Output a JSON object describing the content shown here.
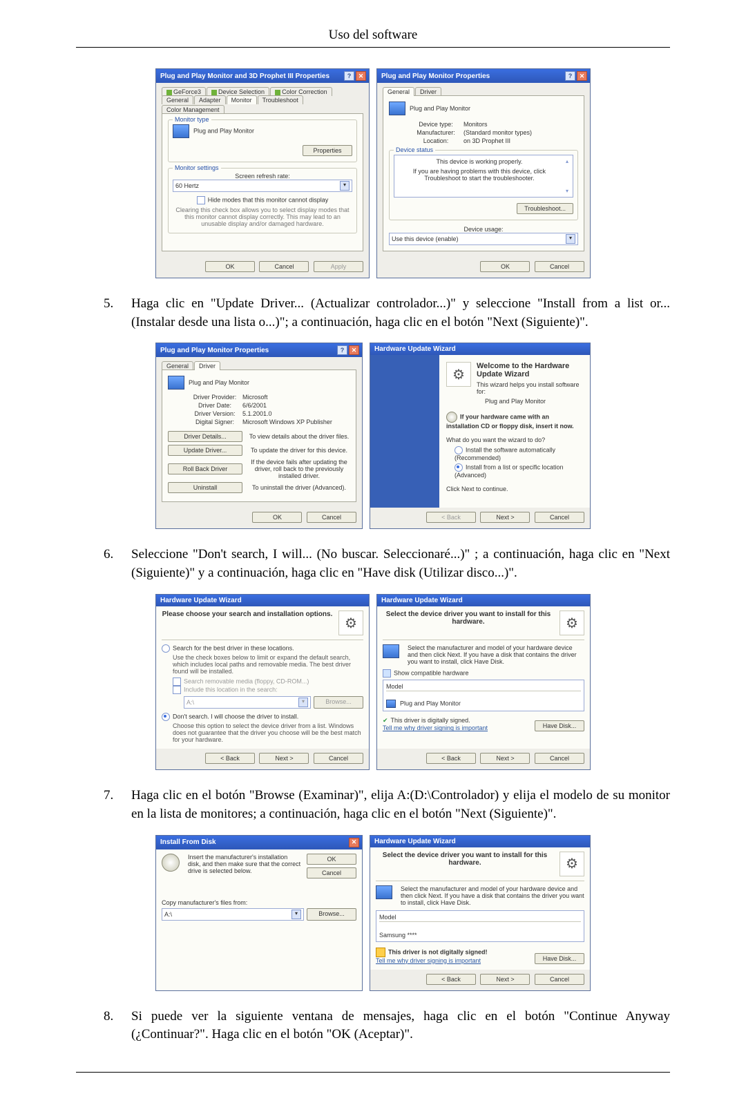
{
  "page": {
    "header": "Uso del software"
  },
  "steps": {
    "s5": {
      "num": "5.",
      "text": "Haga clic en \"Update Driver... (Actualizar controlador...)\" y seleccione \"Install from a list or... (Instalar desde una lista o...)\"; a continuación, haga clic en el botón \"Next (Siguiente)\"."
    },
    "s6": {
      "num": "6.",
      "text": "Seleccione \"Don't search, I will... (No buscar. Seleccionaré...)\" ; a continuación, haga clic en \"Next (Siguiente)\" y a continuación, haga clic en \"Have disk (Utilizar disco...)\"."
    },
    "s7": {
      "num": "7.",
      "text": "Haga clic en el botón \"Browse (Examinar)\", elija A:(D:\\Controlador) y elija el modelo de su monitor en la lista de monitores; a continuación, haga clic en el botón \"Next (Siguiente)\"."
    },
    "s8": {
      "num": "8.",
      "text": "Si puede ver la siguiente ventana de mensajes, haga clic en el botón \"Continue Anyway (¿Continuar?\". Haga clic en el botón \"OK (Aceptar)\"."
    }
  },
  "common": {
    "ok": "OK",
    "cancel": "Cancel",
    "apply": "Apply",
    "back": "< Back",
    "next": "Next >",
    "browse": "Browse...",
    "have_disk": "Have Disk...",
    "chev": "▾",
    "qmark": "?",
    "close": "✕"
  },
  "fig1": {
    "left": {
      "title": "Plug and Play Monitor and 3D Prophet III Properties",
      "tabs": {
        "geforce": "GeForce3",
        "devsel": "Device Selection",
        "colorcorr": "Color Correction",
        "general": "General",
        "adapter": "Adapter",
        "monitor": "Monitor",
        "troubleshoot": "Troubleshoot",
        "colormgmt": "Color Management"
      },
      "monitor_type_label": "Monitor type",
      "monitor_name": "Plug and Play Monitor",
      "properties_btn": "Properties",
      "settings_label": "Monitor settings",
      "refresh_label": "Screen refresh rate:",
      "refresh_value": "60 Hertz",
      "hide_modes": "Hide modes that this monitor cannot display",
      "hide_note": "Clearing this check box allows you to select display modes that this monitor cannot display correctly. This may lead to an unusable display and/or damaged hardware."
    },
    "right": {
      "title": "Plug and Play Monitor Properties",
      "tabs": {
        "general": "General",
        "driver": "Driver"
      },
      "name": "Plug and Play Monitor",
      "devtype_k": "Device type:",
      "devtype_v": "Monitors",
      "manuf_k": "Manufacturer:",
      "manuf_v": "(Standard monitor types)",
      "loc_k": "Location:",
      "loc_v": "on 3D Prophet III",
      "status_label": "Device status",
      "status_text": "This device is working properly.",
      "status_help": "If you are having problems with this device, click Troubleshoot to start the troubleshooter.",
      "troubleshoot_btn": "Troubleshoot...",
      "usage_label": "Device usage:",
      "usage_value": "Use this device (enable)"
    }
  },
  "fig2": {
    "left": {
      "title": "Plug and Play Monitor Properties",
      "tabs": {
        "general": "General",
        "driver": "Driver"
      },
      "name": "Plug and Play Monitor",
      "provider_k": "Driver Provider:",
      "provider_v": "Microsoft",
      "date_k": "Driver Date:",
      "date_v": "6/6/2001",
      "version_k": "Driver Version:",
      "version_v": "5.1.2001.0",
      "signer_k": "Digital Signer:",
      "signer_v": "Microsoft Windows XP Publisher",
      "details_btn": "Driver Details...",
      "details_txt": "To view details about the driver files.",
      "update_btn": "Update Driver...",
      "update_txt": "To update the driver for this device.",
      "rollback_btn": "Roll Back Driver",
      "rollback_txt": "If the device fails after updating the driver, roll back to the previously installed driver.",
      "uninstall_btn": "Uninstall",
      "uninstall_txt": "To uninstall the driver (Advanced)."
    },
    "right": {
      "title": "Hardware Update Wizard",
      "welcome": "Welcome to the Hardware Update Wizard",
      "help": "This wizard helps you install software for:",
      "device": "Plug and Play Monitor",
      "cdnote": "If your hardware came with an installation CD or floppy disk, insert it now.",
      "question": "What do you want the wizard to do?",
      "opt1": "Install the software automatically (Recommended)",
      "opt2": "Install from a list or specific location (Advanced)",
      "continue": "Click Next to continue."
    }
  },
  "fig3": {
    "left": {
      "title": "Hardware Update Wizard",
      "header": "Please choose your search and installation options.",
      "opt1": "Search for the best driver in these locations.",
      "opt1_note": "Use the check boxes below to limit or expand the default search, which includes local paths and removable media. The best driver found will be installed.",
      "chk1": "Search removable media (floppy, CD-ROM...)",
      "chk2": "Include this location in the search:",
      "path": "A:\\",
      "opt2": "Don't search. I will choose the driver to install.",
      "opt2_note": "Choose this option to select the device driver from a list. Windows does not guarantee that the driver you choose will be the best match for your hardware."
    },
    "right": {
      "title": "Hardware Update Wizard",
      "header": "Select the device driver you want to install for this hardware.",
      "instr": "Select the manufacturer and model of your hardware device and then click Next. If you have a disk that contains the driver you want to install, click Have Disk.",
      "compat_chk": "Show compatible hardware",
      "model_lbl": "Model",
      "model_val": "Plug and Play Monitor",
      "signed": "This driver is digitally signed.",
      "why": "Tell me why driver signing is important"
    }
  },
  "fig4": {
    "left": {
      "title": "Install From Disk",
      "instr": "Insert the manufacturer's installation disk, and then make sure that the correct drive is selected below.",
      "copy": "Copy manufacturer's files from:",
      "path": "A:\\"
    },
    "right": {
      "title": "Hardware Update Wizard",
      "header": "Select the device driver you want to install for this hardware.",
      "instr": "Select the manufacturer and model of your hardware device and then click Next. If you have a disk that contains the driver you want to install, click Have Disk.",
      "model_lbl": "Model",
      "model_val": "Samsung ****",
      "notsigned": "This driver is not digitally signed!",
      "why": "Tell me why driver signing is important"
    }
  }
}
